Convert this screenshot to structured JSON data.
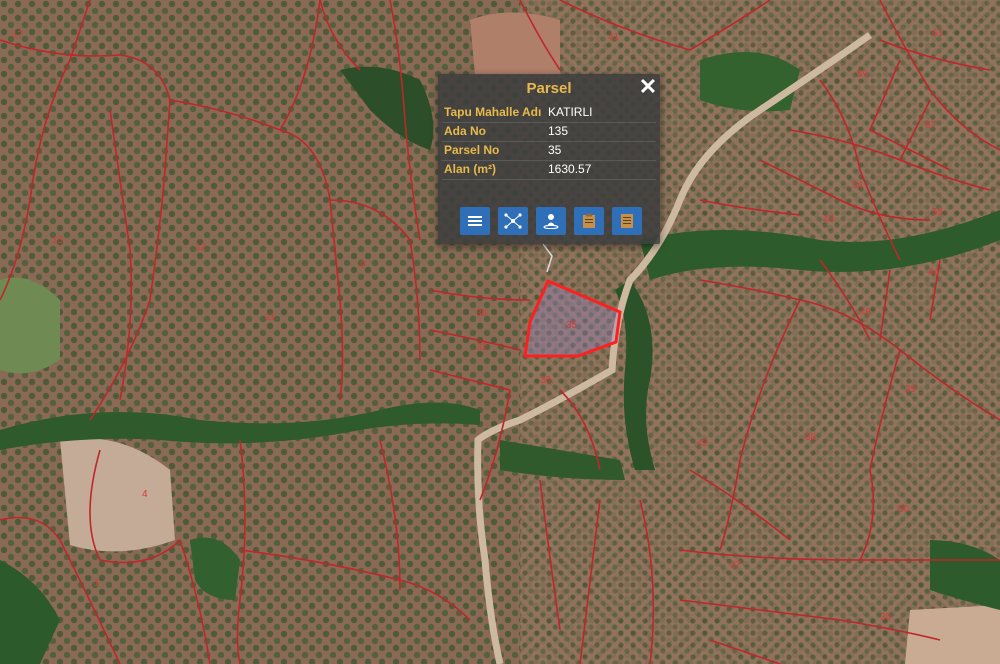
{
  "popup": {
    "title": "Parsel",
    "close_icon": "close-icon",
    "rows": [
      {
        "key": "Tapu Mahalle Adı",
        "value": "KATIRLI"
      },
      {
        "key": "Ada No",
        "value": "135"
      },
      {
        "key": "Parsel No",
        "value": "35"
      },
      {
        "key": "Alan (m²)",
        "value": "1630.57"
      }
    ],
    "tools": [
      {
        "icon": "menu-icon"
      },
      {
        "icon": "network-icon"
      },
      {
        "icon": "person-pin-icon"
      },
      {
        "icon": "clipboard-icon"
      },
      {
        "icon": "document-icon"
      }
    ],
    "accent_color": "#e8ba4e",
    "button_color": "#2f6fb8"
  },
  "map": {
    "boundary_color": "#c0262b",
    "highlight_color": "#ff1f1f",
    "selected_parcel_label": "35",
    "parcel_labels": [
      "41",
      "61",
      "59",
      "57",
      "54",
      "55",
      "43",
      "44",
      "46",
      "42",
      "38",
      "37",
      "36",
      "39",
      "50",
      "29",
      "32",
      "13",
      "9",
      "11",
      "12",
      "17",
      "4",
      "1",
      "35"
    ]
  }
}
